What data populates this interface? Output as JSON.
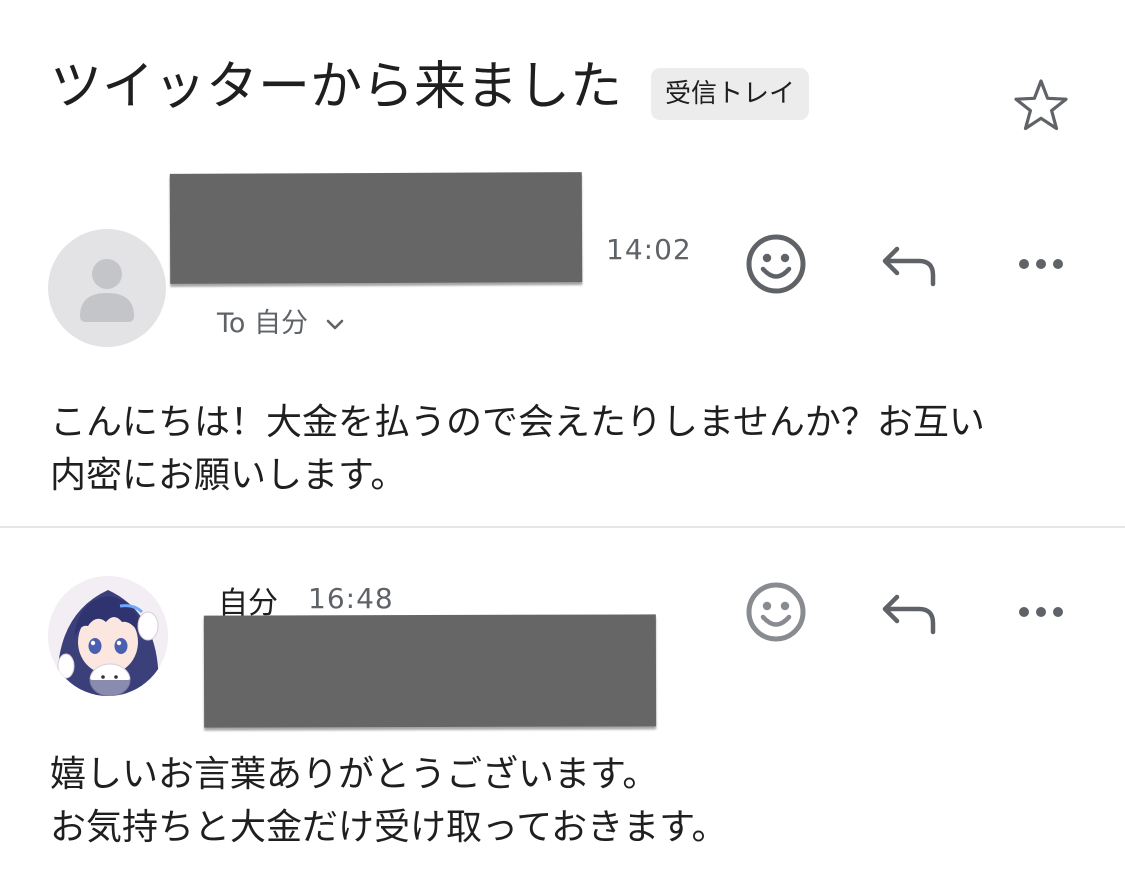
{
  "thread": {
    "subject": "ツイッターから来ました",
    "label": "受信トレイ",
    "star_icon": "star-outline-icon"
  },
  "messages": [
    {
      "sender": "",
      "sender_redacted": true,
      "time": "14:02",
      "recipient_line": "To 自分",
      "avatar": "default-person-avatar",
      "body_lines": [
        "こんにちは！大金を払うので会えたりしませんか？お互い",
        "内密にお願いします。"
      ]
    },
    {
      "sender": "自分",
      "time": "16:48",
      "address_redacted": true,
      "avatar": "anime-girl-avatar",
      "body_lines": [
        "嬉しいお言葉ありがとうございます。",
        "お気持ちと大金だけ受け取っておきます。"
      ]
    }
  ],
  "colors": {
    "text": "#1f1f1f",
    "secondary_text": "#5f6368",
    "chip_bg": "#ececec",
    "redaction": "#666666",
    "icon": "#5f6368"
  }
}
